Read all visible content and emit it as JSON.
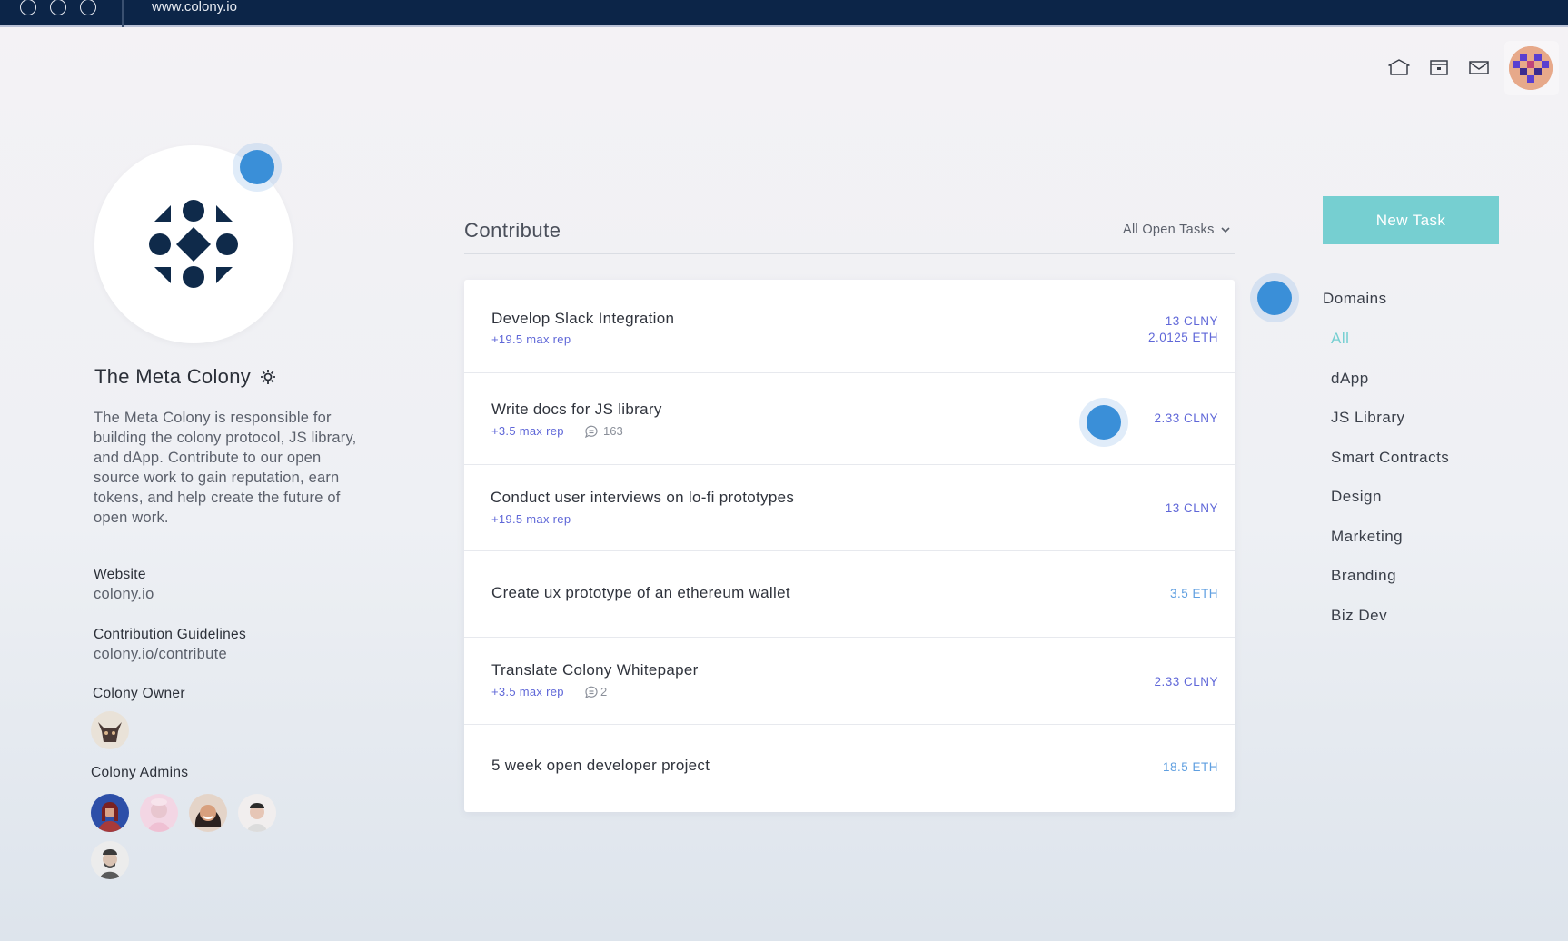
{
  "browser": {
    "url": "www.colony.io"
  },
  "top_nav": {
    "icons": [
      "home-icon",
      "wallet-icon",
      "mail-icon"
    ],
    "avatar": "user-avatar"
  },
  "colony": {
    "name": "The Meta Colony",
    "description": "The Meta Colony is responsible for building the colony protocol, JS library, and dApp. Contribute to our open source work to gain reputation, earn tokens, and help create the future of open work.",
    "website_label": "Website",
    "website_value": "colony.io",
    "guidelines_label": "Contribution Guidelines",
    "guidelines_value": "colony.io/contribute",
    "owner_label": "Colony Owner",
    "admins_label": "Colony Admins"
  },
  "contribute": {
    "title": "Contribute",
    "filter": "All Open Tasks",
    "tasks": [
      {
        "title": "Develop Slack Integration",
        "rep": "+19.5 max rep",
        "comments": "",
        "reward1": "13 CLNY",
        "reward2": "2.0125 ETH"
      },
      {
        "title": "Write docs for JS library",
        "rep": "+3.5 max rep",
        "comments": "163",
        "reward1": "2.33 CLNY",
        "reward2": ""
      },
      {
        "title": "Conduct user interviews on lo-fi prototypes",
        "rep": "+19.5 max rep",
        "comments": "",
        "reward1": "13 CLNY",
        "reward2": ""
      },
      {
        "title": "Create ux prototype of an ethereum wallet",
        "rep": "",
        "comments": "",
        "reward1": "3.5 ETH",
        "reward2": ""
      },
      {
        "title": "Translate Colony Whitepaper",
        "rep": "+3.5 max rep",
        "comments": "2",
        "reward1": "2.33 CLNY",
        "reward2": ""
      },
      {
        "title": "5 week open developer project",
        "rep": "",
        "comments": "",
        "reward1": "18.5 ETH",
        "reward2": ""
      }
    ]
  },
  "sidebar": {
    "new_task_label": "New Task",
    "domains_title": "Domains",
    "domains": [
      "All",
      "dApp",
      "JS Library",
      "Smart Contracts",
      "Design",
      "Marketing",
      "Branding",
      "Biz Dev"
    ]
  },
  "colors": {
    "navy": "#0c2548",
    "accent_teal": "#76cfd1",
    "rep_purple": "#5f67d8",
    "eth_blue": "#5f9fe0",
    "pulse_blue": "#3a8fd8"
  }
}
